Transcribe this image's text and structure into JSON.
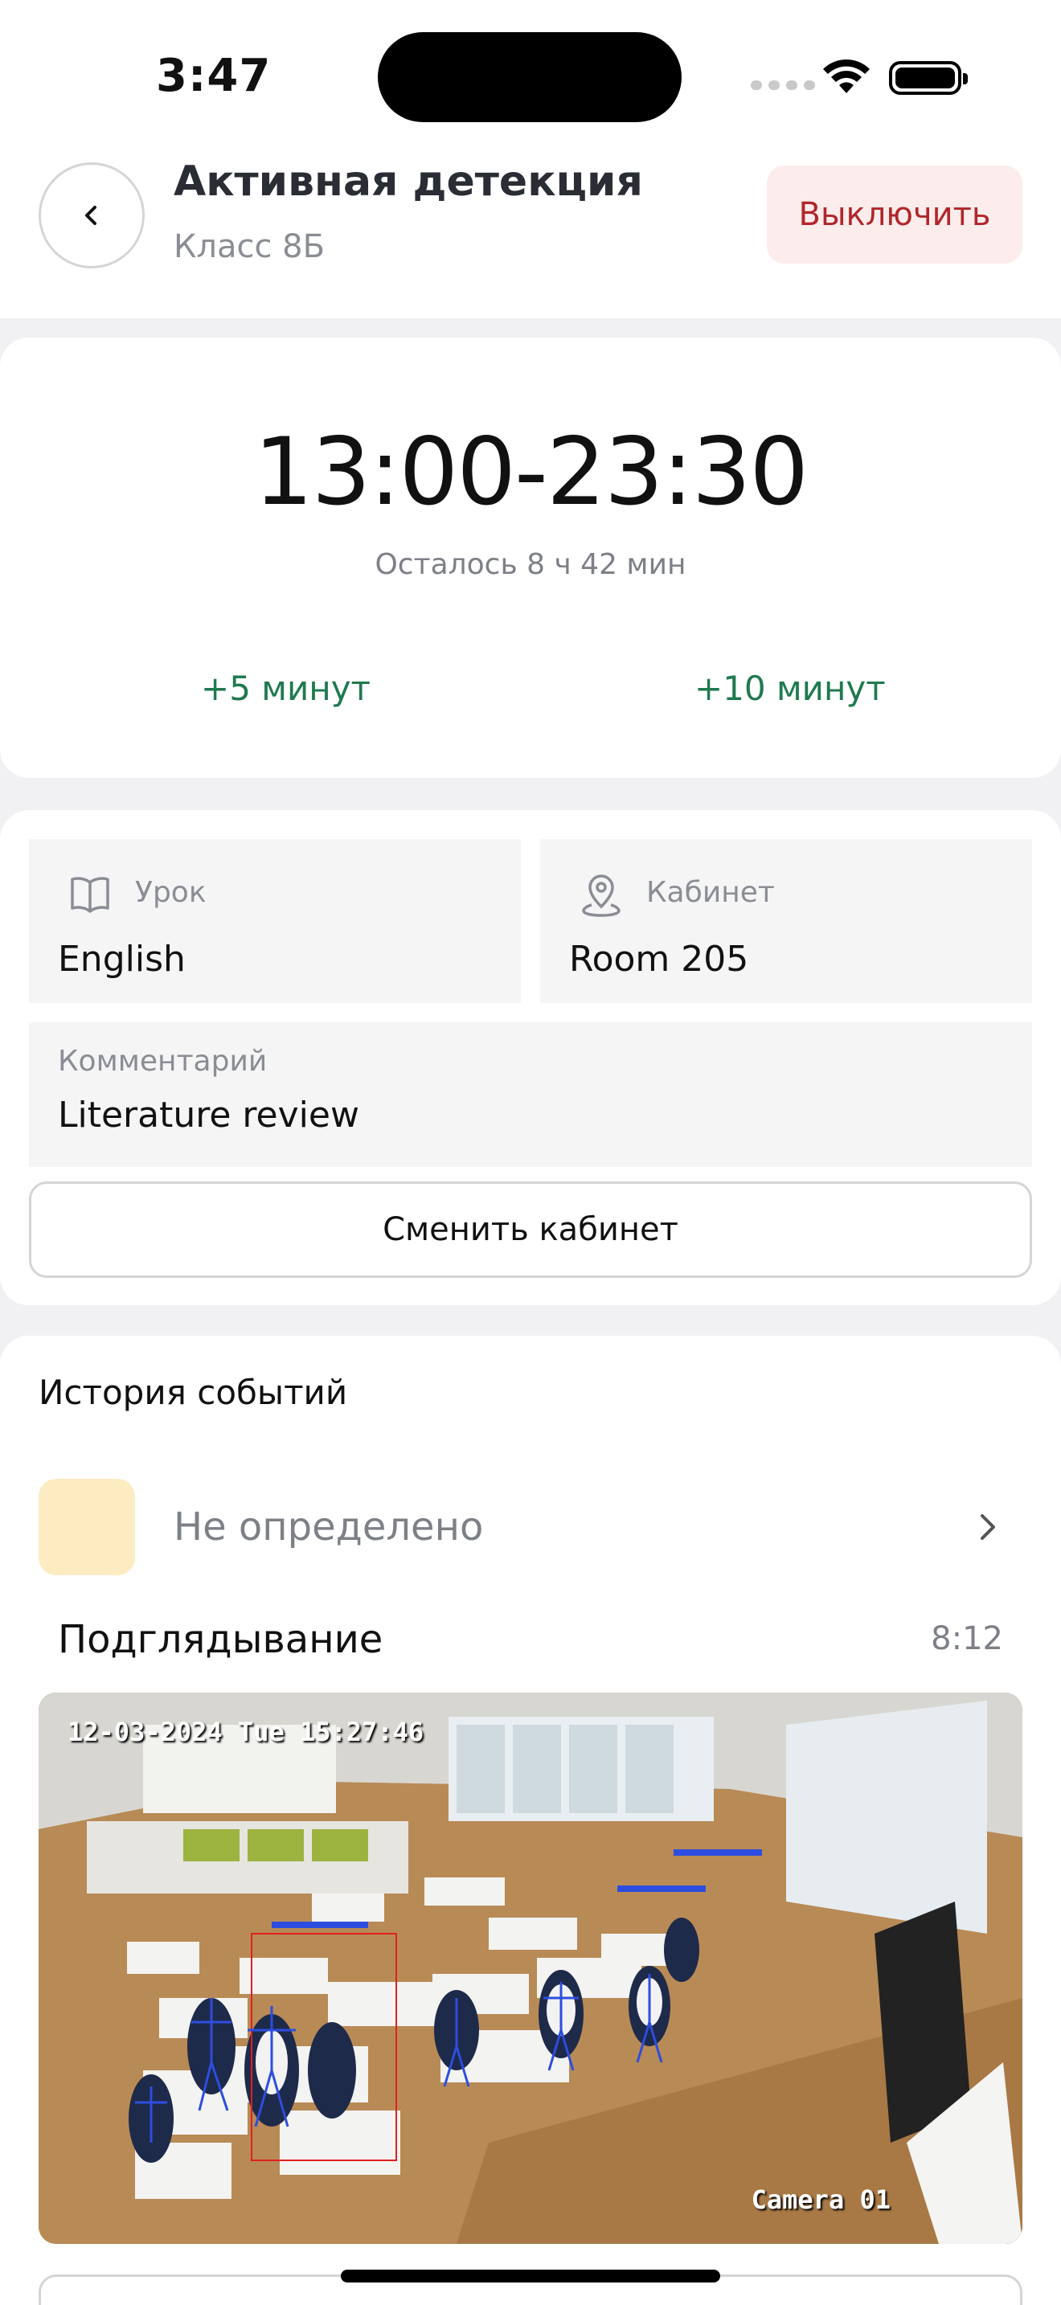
{
  "status_bar": {
    "time": "3:47"
  },
  "header": {
    "title": "Активная детекция",
    "subtitle": "Класс 8Б",
    "off_button": "Выключить"
  },
  "timer": {
    "range": "13:00-23:30",
    "remaining": "Осталось 8 ч 42 мин",
    "add5": "+5 минут",
    "add10": "+10 минут"
  },
  "lesson": {
    "label": "Урок",
    "value": "English"
  },
  "room": {
    "label": "Кабинет",
    "value": "Room 205"
  },
  "comment": {
    "label": "Комментарий",
    "value": "Literature review"
  },
  "change_room": "Сменить кабинет",
  "history": {
    "title": "История событий",
    "status": "Не определено",
    "event_name": "Подглядывание",
    "event_time": "8:12",
    "camera_timestamp": "12-03-2024 Tue 15:27:46",
    "camera_label": "Camera 01"
  },
  "colors": {
    "accent_green": "#1f7a4f",
    "danger_red": "#b1262b",
    "danger_bg": "#fdecec",
    "status_swatch": "#fdebc2"
  },
  "icons": {
    "back": "chevron-left-icon",
    "lesson": "book-icon",
    "room": "location-pin-icon",
    "row": "chevron-right-icon"
  }
}
